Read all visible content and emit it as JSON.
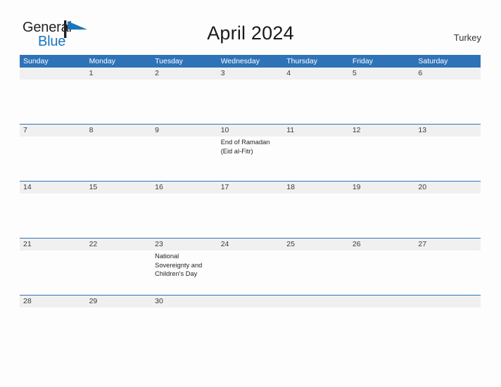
{
  "logo": {
    "word_one": "General",
    "word_two": "Blue",
    "flag_icon": "blue-flag-triangle-icon",
    "dark_color": "#231f20",
    "blue_color": "#1b75bb"
  },
  "header": {
    "title": "April 2024",
    "region": "Turkey"
  },
  "colors": {
    "header_blue": "#2e73b8",
    "row_band_gray": "#f0f0f0",
    "page_background": "#fdfdfd",
    "text_dark": "#222222"
  },
  "weekdays": [
    "Sunday",
    "Monday",
    "Tuesday",
    "Wednesday",
    "Thursday",
    "Friday",
    "Saturday"
  ],
  "weeks": [
    {
      "days": [
        {
          "number": "",
          "events": []
        },
        {
          "number": "1",
          "events": []
        },
        {
          "number": "2",
          "events": []
        },
        {
          "number": "3",
          "events": []
        },
        {
          "number": "4",
          "events": []
        },
        {
          "number": "5",
          "events": []
        },
        {
          "number": "6",
          "events": []
        }
      ]
    },
    {
      "days": [
        {
          "number": "7",
          "events": []
        },
        {
          "number": "8",
          "events": []
        },
        {
          "number": "9",
          "events": []
        },
        {
          "number": "10",
          "events": [
            "End of Ramadan (Eid al-Fitr)"
          ]
        },
        {
          "number": "11",
          "events": []
        },
        {
          "number": "12",
          "events": []
        },
        {
          "number": "13",
          "events": []
        }
      ]
    },
    {
      "days": [
        {
          "number": "14",
          "events": []
        },
        {
          "number": "15",
          "events": []
        },
        {
          "number": "16",
          "events": []
        },
        {
          "number": "17",
          "events": []
        },
        {
          "number": "18",
          "events": []
        },
        {
          "number": "19",
          "events": []
        },
        {
          "number": "20",
          "events": []
        }
      ]
    },
    {
      "days": [
        {
          "number": "21",
          "events": []
        },
        {
          "number": "22",
          "events": []
        },
        {
          "number": "23",
          "events": [
            "National Sovereignty and Children's Day"
          ]
        },
        {
          "number": "24",
          "events": []
        },
        {
          "number": "25",
          "events": []
        },
        {
          "number": "26",
          "events": []
        },
        {
          "number": "27",
          "events": []
        }
      ]
    },
    {
      "days": [
        {
          "number": "28",
          "events": []
        },
        {
          "number": "29",
          "events": []
        },
        {
          "number": "30",
          "events": []
        },
        {
          "number": "",
          "events": []
        },
        {
          "number": "",
          "events": []
        },
        {
          "number": "",
          "events": []
        },
        {
          "number": "",
          "events": []
        }
      ]
    }
  ]
}
